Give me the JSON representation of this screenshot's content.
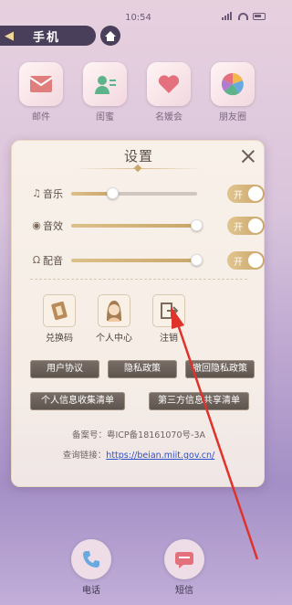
{
  "status_bar": {
    "time": "10:54"
  },
  "nav": {
    "back_icon": "back-arrow-icon",
    "title": "手机",
    "home_icon": "home-icon"
  },
  "apps": [
    {
      "label": "邮件",
      "icon": "mail-icon",
      "color": "#e07e7e"
    },
    {
      "label": "闺蜜",
      "icon": "contacts-icon",
      "color": "#5db38a"
    },
    {
      "label": "名媛会",
      "icon": "heart-icon",
      "color": "#e46f7d"
    },
    {
      "label": "朋友圈",
      "icon": "moments-icon",
      "color": "#6aa8e0"
    }
  ],
  "settings": {
    "title": "设置",
    "close_icon": "close-icon",
    "rows": [
      {
        "label": "音乐",
        "icon": "music-note-icon",
        "level": 0.32,
        "toggle": "开"
      },
      {
        "label": "音效",
        "icon": "sound-effect-icon",
        "level": 1.0,
        "toggle": "开"
      },
      {
        "label": "配音",
        "icon": "headphone-icon",
        "level": 1.0,
        "toggle": "开"
      }
    ],
    "functions": [
      {
        "label": "兑换码",
        "icon": "ticket-icon"
      },
      {
        "label": "个人中心",
        "icon": "avatar-icon"
      },
      {
        "label": "注销",
        "icon": "logout-icon"
      }
    ],
    "buttons": [
      "用户协议",
      "隐私政策",
      "撤回隐私政策",
      "个人信息收集清单",
      "第三方信息共享清单"
    ],
    "record": "备案号：粤ICP备18161070号-3A",
    "query_label": "查询链接：",
    "query_link": "https://beian.miit.gov.cn/"
  },
  "dock": [
    {
      "label": "电话",
      "icon": "phone-icon"
    },
    {
      "label": "短信",
      "icon": "sms-icon"
    }
  ],
  "accent_color": "#c9a56a",
  "annotation_color": "#e0322b"
}
